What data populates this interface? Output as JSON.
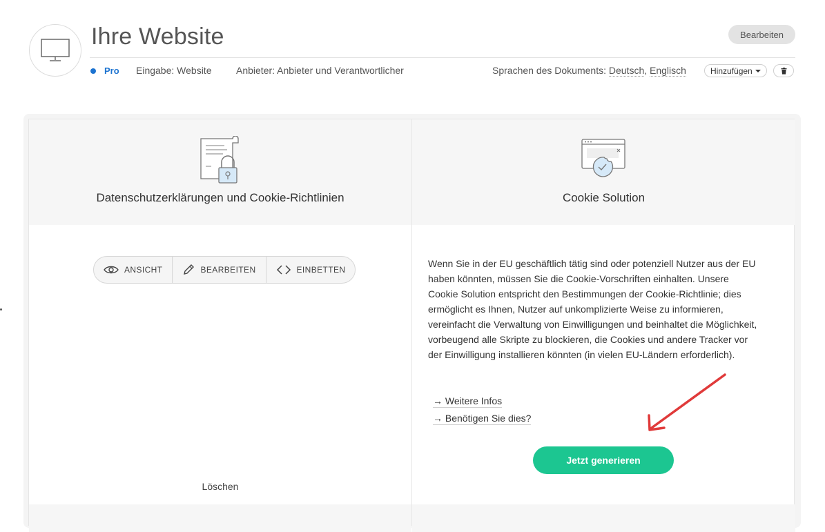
{
  "header": {
    "title": "Ihre Website",
    "edit_label": "Bearbeiten",
    "plan": "Pro",
    "input_type": "Eingabe: Website",
    "provider": "Anbieter: Anbieter und Verantwortlicher",
    "languages_label": "Sprachen des Dokuments:",
    "languages": [
      "Deutsch",
      "Englisch"
    ],
    "add_label": "Hinzufügen",
    "icons": {
      "site": "monitor-icon",
      "trash": "trash-icon"
    }
  },
  "left_panel": {
    "title": "Datenschutzerklärungen und Cookie-Richtlinien",
    "icon": "document-lock-icon",
    "actions": [
      {
        "label": "ANSICHT",
        "icon": "eye-icon"
      },
      {
        "label": "BEARBEITEN",
        "icon": "pencil-icon"
      },
      {
        "label": "EINBETTEN",
        "icon": "code-icon"
      }
    ],
    "delete_label": "Löschen"
  },
  "right_panel": {
    "title": "Cookie Solution",
    "icon": "browser-cookie-icon",
    "description": "Wenn Sie in der EU geschäftlich tätig sind oder potenziell Nutzer aus der EU haben könnten, müssen Sie die Cookie-Vorschriften einhalten. Unsere Cookie Solution entspricht den Bestimmungen der Cookie-Richtlinie; dies ermöglicht es Ihnen, Nutzer auf unkomplizierte Weise zu informieren, vereinfacht die Verwaltung von Einwilligungen und beinhaltet die Möglichkeit, vorbeugend alle Skripte zu blockieren, die Cookies und andere Tracker vor der Einwilligung installieren könnten (in vielen EU-Ländern erforderlich).",
    "links": [
      "→ Weitere Infos",
      "→ Benötigen Sie dies?"
    ],
    "cta_label": "Jetzt generieren"
  },
  "colors": {
    "accent_green": "#1cc691",
    "plan_blue": "#1c73d0",
    "annotation_red": "#e03a3a"
  }
}
